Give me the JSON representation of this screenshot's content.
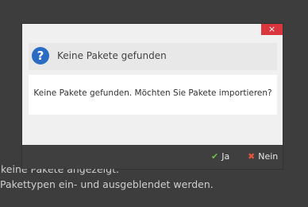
{
  "background": {
    "line1": "keine Pakete angezeigt.",
    "line2": "Pakettypen ein- und ausgeblendet werden."
  },
  "dialog": {
    "close_label": "×",
    "title": "Keine Pakete gefunden",
    "message": "Keine Pakete gefunden. Möchten Sie Pakete importieren?",
    "yes_label": "Ja",
    "no_label": "Nein",
    "icons": {
      "header": "question-icon",
      "yes": "checkmark-icon",
      "no": "cross-icon",
      "close": "close-icon"
    },
    "colors": {
      "accent": "#2a6cc4",
      "close": "#d9363e",
      "yes": "#6fbf4a",
      "no": "#e5533d"
    }
  }
}
